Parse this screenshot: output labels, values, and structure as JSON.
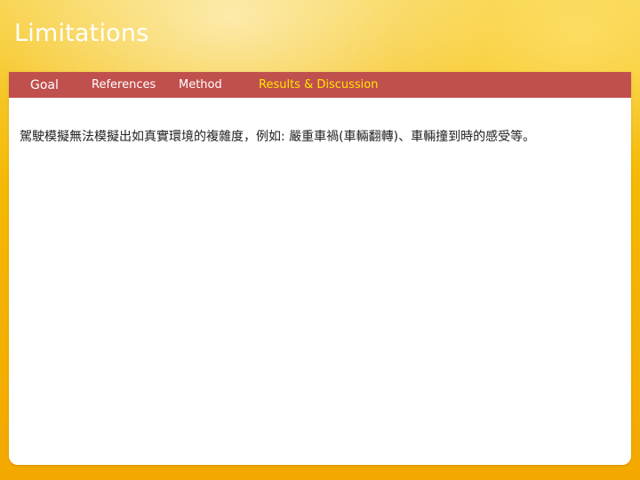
{
  "slide": {
    "title": "Limitations",
    "body_text": "駕駛模擬無法模擬出如真實環境的複雜度，例如: 嚴重車禍(車輛翻轉)、車輛撞到時的感受等。"
  },
  "nav": {
    "items": [
      {
        "label": "Goal"
      },
      {
        "label": "References"
      },
      {
        "label": "Method"
      },
      {
        "label": "Results & Discussion"
      }
    ],
    "active_index": 3
  },
  "colors": {
    "nav_background": "#c0504d",
    "nav_text": "#ffffff",
    "nav_active_text": "#ffe600",
    "slide_background": "#f5b800"
  }
}
